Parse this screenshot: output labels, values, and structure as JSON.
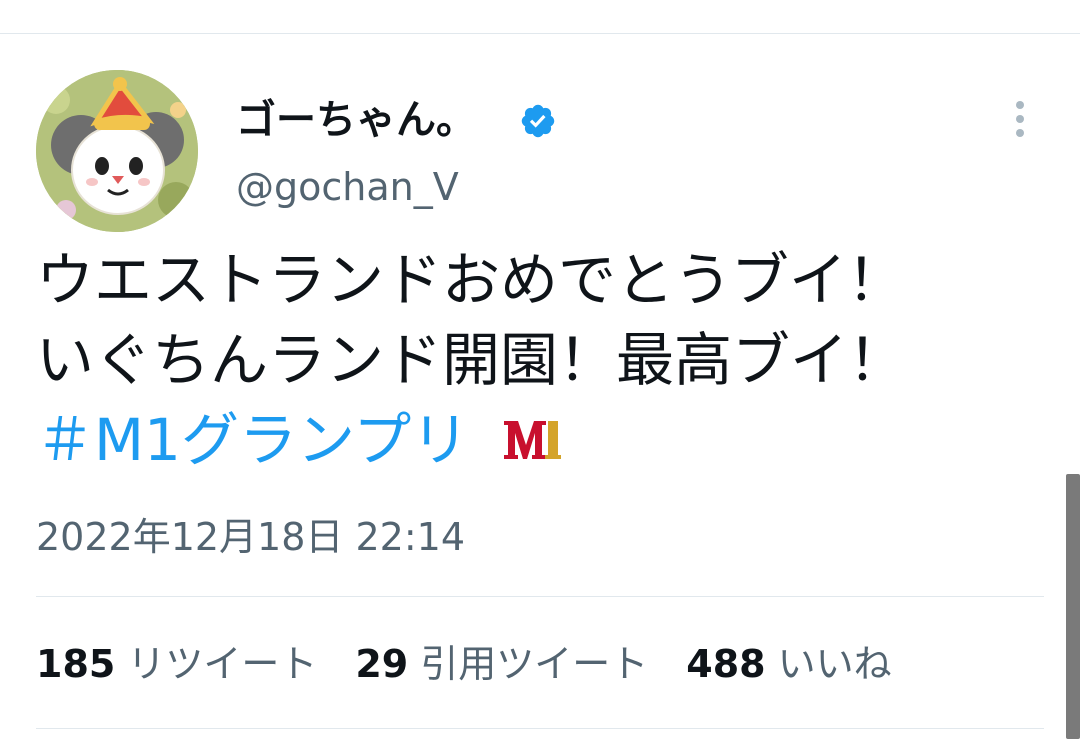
{
  "user": {
    "display_name": "ゴーちゃん。",
    "handle": "@gochan_V",
    "verified": true,
    "avatar_icon": "panda-mascot-avatar"
  },
  "tweet": {
    "line1": "ウエストランドおめでとうブイ！",
    "line2": "いぐちんランド開園！最高ブイ！",
    "hashtag": "＃M1グランプリ",
    "hashtag_emoji": "m1-logo-icon",
    "timestamp": "2022年12月18日 22:14"
  },
  "stats": [
    {
      "count": "185",
      "label": "リツイート"
    },
    {
      "count": "29",
      "label": "引用ツイート"
    },
    {
      "count": "488",
      "label": "いいね"
    }
  ],
  "colors": {
    "link": "#1d9bf0",
    "secondary_text": "#536471",
    "primary_text": "#0f1419",
    "divider": "#e1e8ed",
    "verified": "#1d9bf0"
  }
}
